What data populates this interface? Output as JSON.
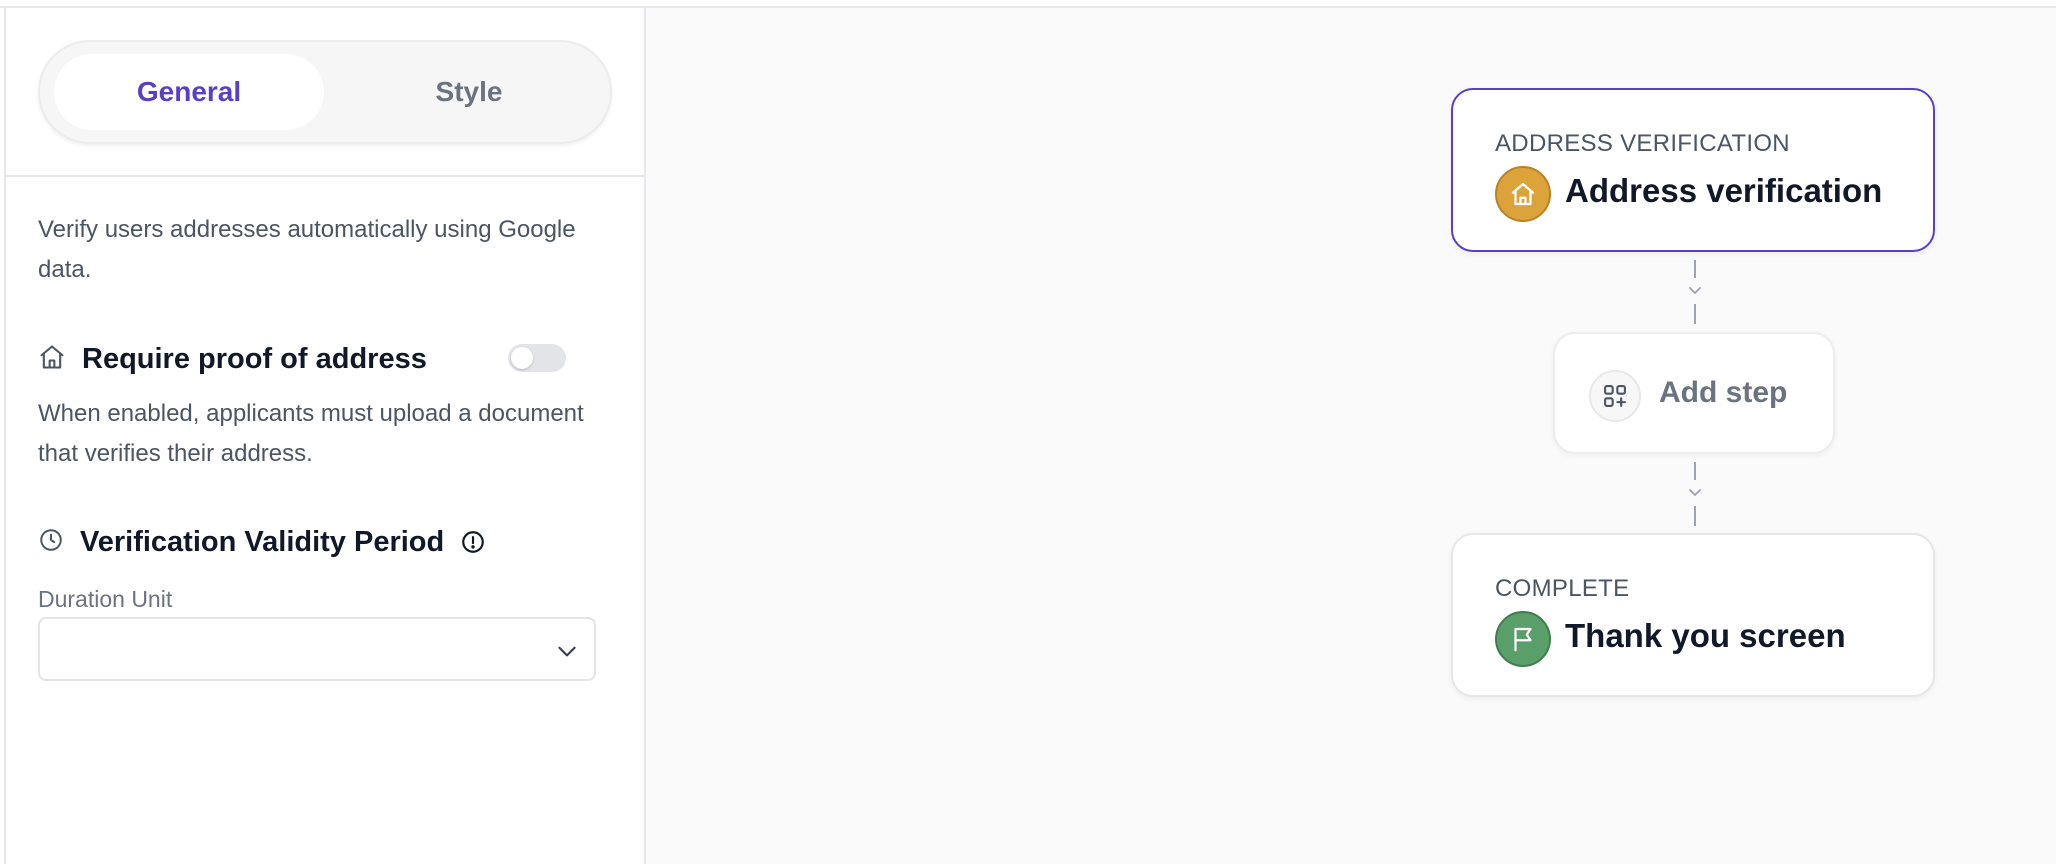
{
  "sidebar": {
    "tabs": [
      {
        "label": "General",
        "active": true
      },
      {
        "label": "Style",
        "active": false
      }
    ],
    "description": "Verify users addresses automatically using Google data.",
    "proof": {
      "title": "Require proof of address",
      "enabled": false,
      "help": "When enabled, applicants must upload a document that verifies their address."
    },
    "validity": {
      "title": "Verification Validity Period",
      "duration_label": "Duration Unit",
      "duration_value": ""
    }
  },
  "flow": {
    "nodes": [
      {
        "kicker": "ADDRESS VERIFICATION",
        "title": "Address verification",
        "icon": "house-icon",
        "color": "#dca33b",
        "selected": true
      },
      {
        "kicker": "COMPLETE",
        "title": "Thank you screen",
        "icon": "flag-icon",
        "color": "#5a9e6a",
        "selected": false
      }
    ],
    "add_step_label": "Add step"
  },
  "colors": {
    "accent": "#5b3ec8",
    "border": "#e5e7eb",
    "canvas": "#fafafa"
  }
}
